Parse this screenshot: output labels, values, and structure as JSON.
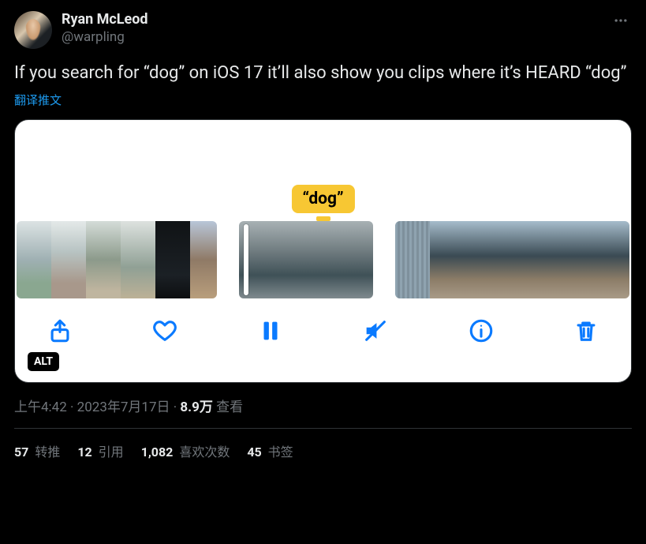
{
  "author": {
    "display_name": "Ryan McLeod",
    "handle": "@warpling"
  },
  "tweet_text": "If you search for “dog” on iOS 17 it’ll also show you clips where it’s HEARD “dog”",
  "translate_label": "翻译推文",
  "media": {
    "tag_pill": "“dog”",
    "alt_badge": "ALT",
    "controls": {
      "share": "share-icon",
      "like": "heart-icon",
      "pause": "pause-icon",
      "mute": "mute-icon",
      "info": "info-icon",
      "trash": "trash-icon"
    }
  },
  "metadata": {
    "time": "上午4:42",
    "dot1": " · ",
    "date": "2023年7月17日",
    "dot2": " · ",
    "views_number": "8.9万",
    "views_label": " 查看"
  },
  "stats": {
    "retweets": {
      "count": "57",
      "label": " 转推"
    },
    "quotes": {
      "count": "12",
      "label": " 引用"
    },
    "likes": {
      "count": "1,082",
      "label": " 喜欢次数"
    },
    "bookmarks": {
      "count": "45",
      "label": " 书签"
    }
  }
}
